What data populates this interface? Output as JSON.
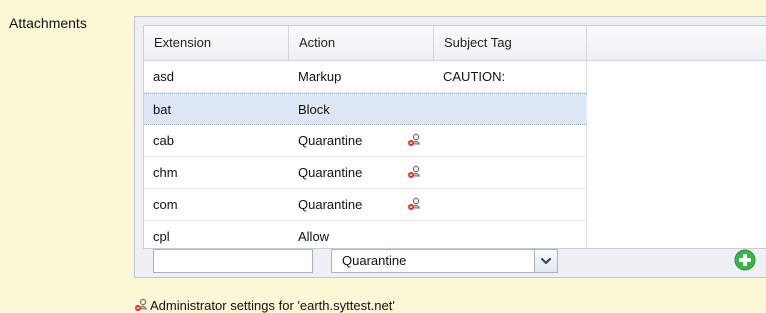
{
  "section": {
    "label": "Attachments"
  },
  "grid": {
    "columns": [
      "Extension",
      "Action",
      "Subject Tag"
    ],
    "rows": [
      {
        "extension": "asd",
        "action": "Markup",
        "subject_tag": "CAUTION:",
        "admin_setting": false,
        "selected": false
      },
      {
        "extension": "bat",
        "action": "Block",
        "subject_tag": "",
        "admin_setting": false,
        "selected": true
      },
      {
        "extension": "cab",
        "action": "Quarantine",
        "subject_tag": "",
        "admin_setting": true,
        "selected": false
      },
      {
        "extension": "chm",
        "action": "Quarantine",
        "subject_tag": "",
        "admin_setting": true,
        "selected": false
      },
      {
        "extension": "com",
        "action": "Quarantine",
        "subject_tag": "",
        "admin_setting": true,
        "selected": false
      },
      {
        "extension": "cpl",
        "action": "Allow",
        "subject_tag": "",
        "admin_setting": false,
        "selected": false
      }
    ]
  },
  "editor": {
    "extension_value": "",
    "action_selected": "Quarantine"
  },
  "footer": {
    "note": "Administrator settings for 'earth.syttest.net'"
  },
  "icons": {
    "admin": "admin-user-icon",
    "add": "add-plus-icon",
    "dropdown": "chevron-down-icon"
  },
  "colors": {
    "page_bg": "#fcf8d6",
    "selected_row": "#dde7f6",
    "add_button": "#3bb54a"
  }
}
